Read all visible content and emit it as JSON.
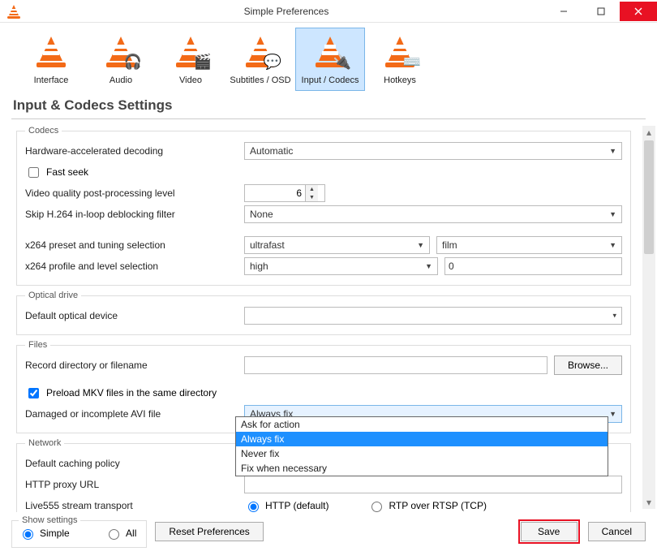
{
  "window": {
    "title": "Simple Preferences"
  },
  "tabs": {
    "interface": "Interface",
    "audio": "Audio",
    "video": "Video",
    "subtitles": "Subtitles / OSD",
    "input_codecs": "Input / Codecs",
    "hotkeys": "Hotkeys"
  },
  "page_title": "Input & Codecs Settings",
  "codecs": {
    "legend": "Codecs",
    "hw_decode_label": "Hardware-accelerated decoding",
    "hw_decode_value": "Automatic",
    "fast_seek_label": "Fast seek",
    "pp_level_label": "Video quality post-processing level",
    "pp_level_value": "6",
    "skip_deblock_label": "Skip H.264 in-loop deblocking filter",
    "skip_deblock_value": "None",
    "x264_preset_label": "x264 preset and tuning selection",
    "x264_preset_value": "ultrafast",
    "x264_tune_value": "film",
    "x264_profile_label": "x264 profile and level selection",
    "x264_profile_value": "high",
    "x264_level_value": "0"
  },
  "optical": {
    "legend": "Optical drive",
    "default_device_label": "Default optical device",
    "default_device_value": ""
  },
  "files": {
    "legend": "Files",
    "record_label": "Record directory or filename",
    "record_value": "",
    "browse_label": "Browse...",
    "preload_mkv_label": "Preload MKV files in the same directory",
    "damaged_avi_label": "Damaged or incomplete AVI file",
    "damaged_avi_value": "Always fix",
    "damaged_avi_options": {
      "ask": "Ask for action",
      "always": "Always fix",
      "never": "Never fix",
      "when_necessary": "Fix when necessary"
    }
  },
  "network": {
    "legend": "Network",
    "caching_label": "Default caching policy",
    "proxy_label": "HTTP proxy URL",
    "proxy_value": "",
    "live555_label": "Live555 stream transport",
    "live555_http": "HTTP (default)",
    "live555_rtsp": "RTP over RTSP (TCP)"
  },
  "footer": {
    "show_settings_legend": "Show settings",
    "simple": "Simple",
    "all": "All",
    "reset": "Reset Preferences",
    "save": "Save",
    "cancel": "Cancel"
  }
}
